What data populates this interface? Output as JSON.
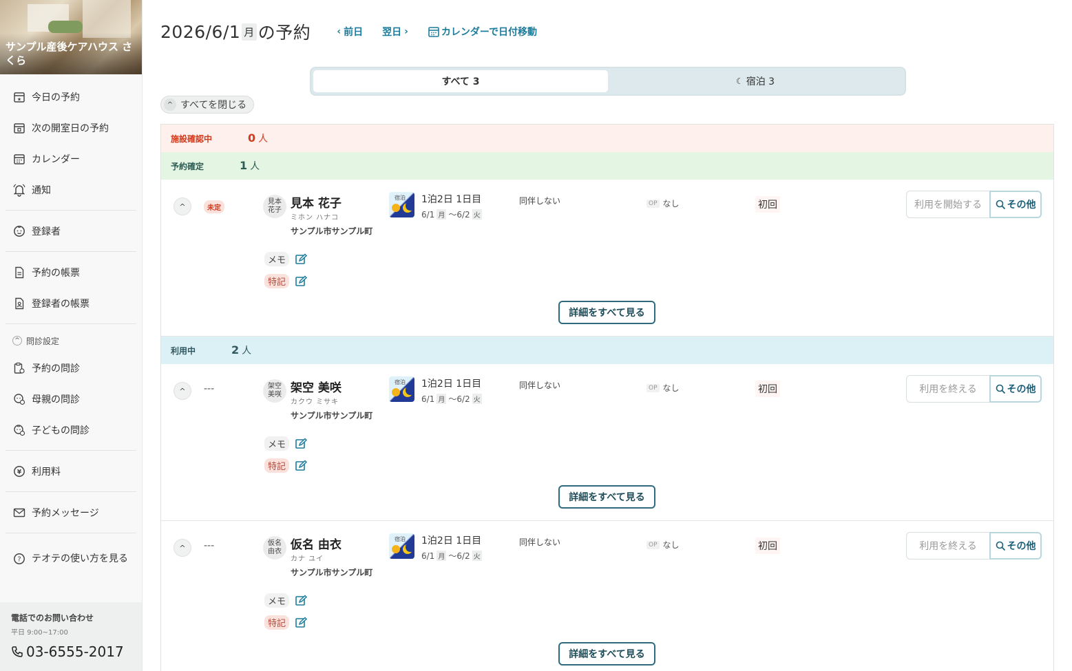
{
  "sidebar": {
    "facility_name": "サンプル産後ケアハウス さくら",
    "items": [
      {
        "label": "今日の予約",
        "icon": "calendar-star-icon"
      },
      {
        "label": "次の開室日の予約",
        "icon": "calendar-next-icon"
      },
      {
        "label": "カレンダー",
        "icon": "calendar-icon"
      },
      {
        "label": "通知",
        "icon": "bell-icon"
      },
      {
        "label": "登録者",
        "icon": "baby-face-icon"
      },
      {
        "label": "予約の帳票",
        "icon": "document-icon"
      },
      {
        "label": "登録者の帳票",
        "icon": "document-person-icon"
      },
      {
        "label": "予約の問診",
        "icon": "clipboard-icon"
      },
      {
        "label": "母親の問診",
        "icon": "mother-icon"
      },
      {
        "label": "子どもの問診",
        "icon": "child-icon"
      },
      {
        "label": "利用料",
        "icon": "yen-icon"
      },
      {
        "label": "予約メッセージ",
        "icon": "mail-icon"
      },
      {
        "label": "テオテの使い方を見る",
        "icon": "help-icon"
      }
    ],
    "group_label": "問診設定",
    "contact": {
      "title": "電話でのお問い合わせ",
      "hours": "平日 9:00~17:00",
      "phone": "03-6555-2017"
    }
  },
  "header": {
    "date": "2026/6/1",
    "dow": "月",
    "suffix": "の予約",
    "prev": "前日",
    "next": "翌日",
    "calendar": "カレンダーで日付移動"
  },
  "tabs": {
    "all": "すべて 3",
    "stay": "宿泊 3"
  },
  "collapse_all": "すべてを閉じる",
  "status": {
    "pending": {
      "label": "施設確認中",
      "count": "0",
      "unit": "人"
    },
    "confirmed": {
      "label": "予約確定",
      "count": "1",
      "unit": "人"
    },
    "inuse": {
      "label": "利用中",
      "count": "2",
      "unit": "人"
    }
  },
  "reservations": [
    {
      "state": "未定",
      "avatar": "見本\n花子",
      "name": "見本 花子",
      "kana": "ミホン ハナコ",
      "address": "サンプル市サンプル町",
      "stay_label": "宿泊",
      "stay": "1泊2日 1日目",
      "date_from": "6/1",
      "dow_from": "月",
      "date_sep": "〜",
      "date_to": "6/2",
      "dow_to": "火",
      "companion": "同伴しない",
      "op": "OP",
      "option": "なし",
      "visit": "初回",
      "action": "利用を開始する",
      "other": "その他",
      "memo": "メモ",
      "note": "特記",
      "details": "詳細をすべて見る"
    },
    {
      "state": "---",
      "avatar": "架空\n美咲",
      "name": "架空 美咲",
      "kana": "カクウ ミサキ",
      "address": "サンプル市サンプル町",
      "stay_label": "宿泊",
      "stay": "1泊2日 1日目",
      "date_from": "6/1",
      "dow_from": "月",
      "date_sep": "〜",
      "date_to": "6/2",
      "dow_to": "火",
      "companion": "同伴しない",
      "op": "OP",
      "option": "なし",
      "visit": "初回",
      "action": "利用を終える",
      "other": "その他",
      "memo": "メモ",
      "note": "特記",
      "details": "詳細をすべて見る"
    },
    {
      "state": "---",
      "avatar": "仮名\n由衣",
      "name": "仮名 由衣",
      "kana": "カナ ユイ",
      "address": "サンプル市サンプル町",
      "stay_label": "宿泊",
      "stay": "1泊2日 1日目",
      "date_from": "6/1",
      "dow_from": "月",
      "date_sep": "〜",
      "date_to": "6/2",
      "dow_to": "火",
      "companion": "同伴しない",
      "op": "OP",
      "option": "なし",
      "visit": "初回",
      "action": "利用を終える",
      "other": "その他",
      "memo": "メモ",
      "note": "特記",
      "details": "詳細をすべて見る"
    }
  ],
  "colors": {
    "accent": "#1b7c9c",
    "pending_bg": "#fdf0ed",
    "confirmed_bg": "#e4f6e3",
    "inuse_bg": "#dcf1f5",
    "alert": "#d23b1e"
  }
}
